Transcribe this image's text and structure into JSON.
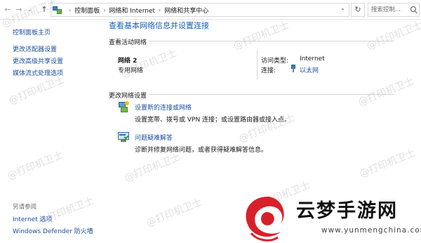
{
  "address_bar": {
    "back_glyph": "←",
    "forward_glyph": "→",
    "history_glyph": "⌄",
    "up_glyph": "↑",
    "breadcrumbs": [
      "控制面板",
      "网络和 Internet",
      "网络和共享中心"
    ],
    "crumb_separator": "›",
    "dropdown_glyph": "⌄",
    "refresh_glyph": "↻",
    "search_placeholder": "搜索控制..."
  },
  "sidebar": {
    "links": [
      "控制面板主页",
      "更改适配器设置",
      "更改高级共享设置",
      "媒体流式处理选项"
    ],
    "see_also_title": "另请参阅",
    "see_also_links": [
      "Internet 选项",
      "Windows Defender 防火墙"
    ]
  },
  "main": {
    "title": "查看基本网络信息并设置连接",
    "active_networks_label": "查看活动网络",
    "network": {
      "name": "网络 2",
      "category": "专用网络",
      "access_type_label": "访问类型:",
      "access_type_value": "Internet",
      "connections_label": "连接:",
      "connections_value": "以太网"
    },
    "change_settings_label": "更改网络设置",
    "actions": [
      {
        "title": "设置新的连接或网络",
        "description": "设置宽带、拨号或 VPN 连接；或设置路由器或接入点。",
        "icon": "setup-connection-icon"
      },
      {
        "title": "问题疑难解答",
        "description": "诊断并修复网络问题，或者获得疑难解答信息。",
        "icon": "troubleshoot-icon"
      }
    ]
  },
  "watermark_text": "@打印机卫士",
  "logo": {
    "name": "云梦手游网",
    "url": "www.yunmengchina.com"
  },
  "colors": {
    "link": "#1c4f9c",
    "title": "#1a5fb4",
    "logo_red": "#d8202a"
  }
}
